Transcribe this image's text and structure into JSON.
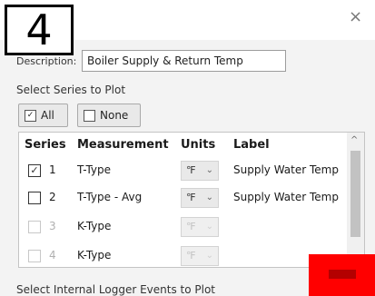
{
  "step_number": "4",
  "window": {
    "close_glyph": "×"
  },
  "description": {
    "label": "Description:",
    "value": "Boiler Supply & Return Temp"
  },
  "series_section": {
    "heading": "Select Series to Plot"
  },
  "buttons": {
    "all_label": "All",
    "none_label": "None"
  },
  "table": {
    "headers": {
      "series": "Series",
      "measurement": "Measurement",
      "units": "Units",
      "label": "Label"
    },
    "rows": [
      {
        "checked": true,
        "enabled": true,
        "number": "1",
        "measurement": "T-Type",
        "unit": "℉",
        "label": "Supply Water Temp"
      },
      {
        "checked": false,
        "enabled": true,
        "number": "2",
        "measurement": "T-Type - Avg",
        "unit": "℉",
        "label": "Supply Water Temp"
      },
      {
        "checked": false,
        "enabled": false,
        "number": "3",
        "measurement": "K-Type",
        "unit": "℉",
        "label": ""
      },
      {
        "checked": false,
        "enabled": false,
        "number": "4",
        "measurement": "K-Type",
        "unit": "℉",
        "label": ""
      }
    ],
    "check_glyph": "✓",
    "caret_glyph": "⌄",
    "scroll_up_glyph": "^"
  },
  "events_section": {
    "heading": "Select Internal Logger Events to Plot"
  },
  "colors": {
    "redaction": "#ff0000"
  }
}
